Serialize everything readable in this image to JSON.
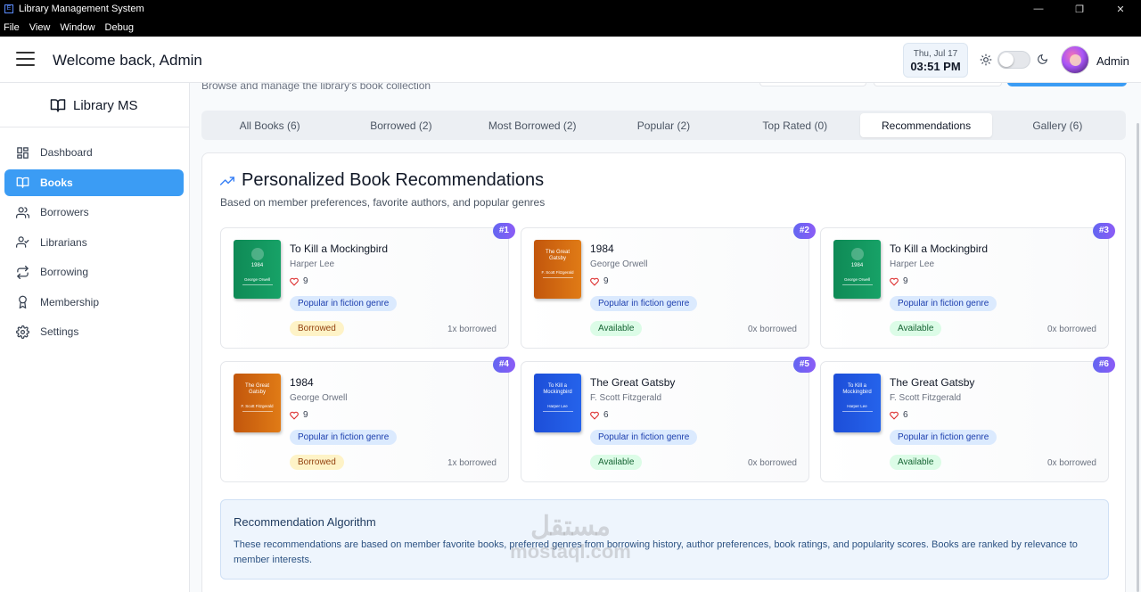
{
  "window": {
    "title": "Library Management System",
    "app_icon": "E",
    "menu": [
      "File",
      "View",
      "Window",
      "Debug"
    ],
    "controls": {
      "minimize": "—",
      "maximize": "❐",
      "close": "✕"
    }
  },
  "header": {
    "welcome": "Welcome back, Admin",
    "date": "Thu, Jul 17",
    "time": "03:51 PM",
    "theme_toggle": "light",
    "user_name": "Admin"
  },
  "sidebar": {
    "brand": "Library MS",
    "items": [
      {
        "label": "Dashboard",
        "icon": "dashboard-icon",
        "active": false
      },
      {
        "label": "Books",
        "icon": "book-icon",
        "active": true
      },
      {
        "label": "Borrowers",
        "icon": "users-icon",
        "active": false
      },
      {
        "label": "Librarians",
        "icon": "user-check-icon",
        "active": false
      },
      {
        "label": "Borrowing",
        "icon": "swap-icon",
        "active": false
      },
      {
        "label": "Membership",
        "icon": "award-icon",
        "active": false
      },
      {
        "label": "Settings",
        "icon": "gear-icon",
        "active": false
      }
    ]
  },
  "main": {
    "subtitle": "Browse and manage the library's book collection",
    "tabs": [
      {
        "label": "All Books (6)",
        "active": false
      },
      {
        "label": "Borrowed (2)",
        "active": false
      },
      {
        "label": "Most Borrowed (2)",
        "active": false
      },
      {
        "label": "Popular (2)",
        "active": false
      },
      {
        "label": "Top Rated (0)",
        "active": false
      },
      {
        "label": "Recommendations",
        "active": true
      },
      {
        "label": "Gallery (6)",
        "active": false
      }
    ],
    "recommendations": {
      "title": "Personalized Book Recommendations",
      "description": "Based on member preferences, favorite authors, and popular genres",
      "cards": [
        {
          "rank": "#1",
          "title": "To Kill a Mockingbird",
          "author": "Harper Lee",
          "likes": "9",
          "reason": "Popular in fiction genre",
          "status": "Borrowed",
          "borrow_count": "1x borrowed",
          "cover": {
            "color": "green",
            "title": "1984",
            "author": "George Orwell"
          }
        },
        {
          "rank": "#2",
          "title": "1984",
          "author": "George Orwell",
          "likes": "9",
          "reason": "Popular in fiction genre",
          "status": "Available",
          "borrow_count": "0x borrowed",
          "cover": {
            "color": "orange",
            "title": "The Great Gatsby",
            "author": "F. Scott Fitzgerald"
          }
        },
        {
          "rank": "#3",
          "title": "To Kill a Mockingbird",
          "author": "Harper Lee",
          "likes": "9",
          "reason": "Popular in fiction genre",
          "status": "Available",
          "borrow_count": "0x borrowed",
          "cover": {
            "color": "green",
            "title": "1984",
            "author": "George Orwell"
          }
        },
        {
          "rank": "#4",
          "title": "1984",
          "author": "George Orwell",
          "likes": "9",
          "reason": "Popular in fiction genre",
          "status": "Borrowed",
          "borrow_count": "1x borrowed",
          "cover": {
            "color": "orange",
            "title": "The Great Gatsby",
            "author": "F. Scott Fitzgerald"
          }
        },
        {
          "rank": "#5",
          "title": "The Great Gatsby",
          "author": "F. Scott Fitzgerald",
          "likes": "6",
          "reason": "Popular in fiction genre",
          "status": "Available",
          "borrow_count": "0x borrowed",
          "cover": {
            "color": "blue",
            "title": "To Kill a Mockingbird",
            "author": "Harper Lee"
          }
        },
        {
          "rank": "#6",
          "title": "The Great Gatsby",
          "author": "F. Scott Fitzgerald",
          "likes": "6",
          "reason": "Popular in fiction genre",
          "status": "Available",
          "borrow_count": "0x borrowed",
          "cover": {
            "color": "blue",
            "title": "To Kill a Mockingbird",
            "author": "Harper Lee"
          }
        }
      ],
      "algorithm": {
        "title": "Recommendation Algorithm",
        "text": "These recommendations are based on member favorite books, preferred genres from borrowing history, author preferences, book ratings, and popularity scores. Books are ranked by relevance to member interests."
      }
    }
  },
  "watermark": {
    "arabic": "مستقل",
    "latin": "mostaql.com"
  },
  "colors": {
    "accent": "#3b9cf4",
    "rank_badge": "#6366f1",
    "borrowed": "#fef3c7",
    "available": "#dcfce7",
    "reason": "#dbeafe"
  }
}
